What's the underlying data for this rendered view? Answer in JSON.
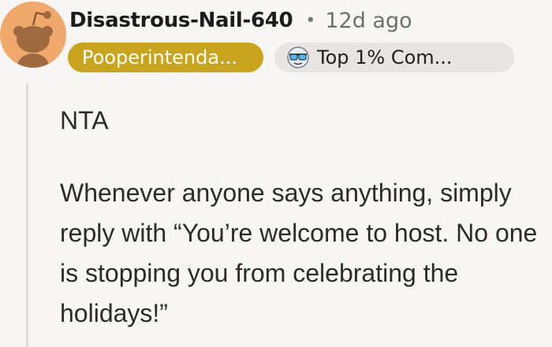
{
  "comment": {
    "username": "Disastrous-Nail-640",
    "separator": "•",
    "timestamp": "12d ago",
    "flair": "Pooperintenda...",
    "badge": {
      "icon": "sunglasses-face-icon",
      "label": "Top 1% Com..."
    },
    "body": [
      "NTA",
      "Whenever anyone says anything, simply reply with “You’re welcome to host. No one is stopping you from celebrating the holidays!”"
    ]
  },
  "colors": {
    "background": "#f7f6f5",
    "avatar": "#f0a86b",
    "flair_bg": "#c8a51d",
    "badge_bg": "#e7e4e1",
    "thread_line": "#dcdbd9"
  }
}
